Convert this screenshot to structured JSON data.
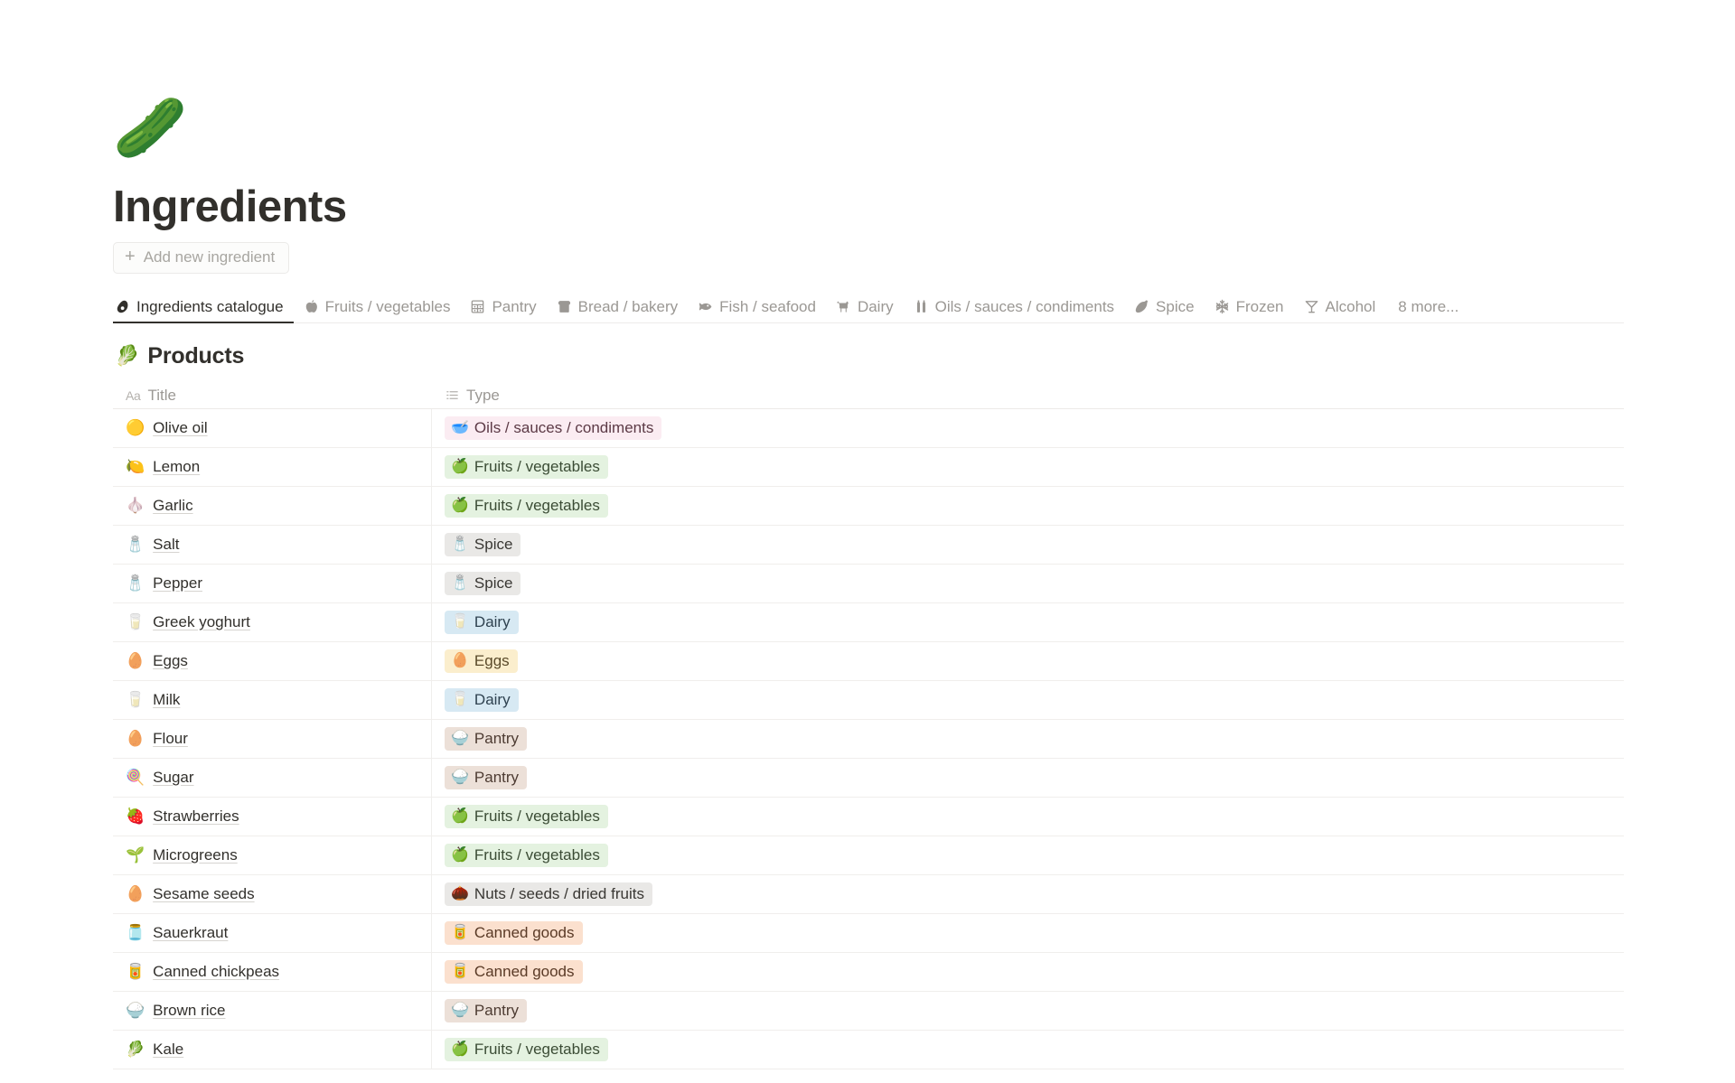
{
  "header": {
    "emoji": "🥒",
    "emoji_name": "cucumber-emoji",
    "title": "Ingredients",
    "add_button_label": "Add new ingredient",
    "add_button_plus": "+"
  },
  "tabs": {
    "items": [
      {
        "label": "Ingredients catalogue",
        "icon": "avocado-icon",
        "active": true
      },
      {
        "label": "Fruits / vegetables",
        "icon": "apple-icon",
        "active": false
      },
      {
        "label": "Pantry",
        "icon": "cabinet-icon",
        "active": false
      },
      {
        "label": "Bread / bakery",
        "icon": "bread-icon",
        "active": false
      },
      {
        "label": "Fish / seafood",
        "icon": "fish-icon",
        "active": false
      },
      {
        "label": "Dairy",
        "icon": "cow-icon",
        "active": false
      },
      {
        "label": "Oils / sauces / condiments",
        "icon": "bottles-icon",
        "active": false
      },
      {
        "label": "Spice",
        "icon": "chili-pepper-icon",
        "active": false
      },
      {
        "label": "Frozen",
        "icon": "snowflake-icon",
        "active": false
      },
      {
        "label": "Alcohol",
        "icon": "cocktail-glass-icon",
        "active": false
      }
    ],
    "more_label": "8 more..."
  },
  "section": {
    "emoji": "🥬",
    "emoji_name": "leafy-green-emoji",
    "title": "Products"
  },
  "table": {
    "columns": [
      {
        "label": "Title",
        "icon": "text-type-icon"
      },
      {
        "label": "Type",
        "icon": "multi-select-icon"
      }
    ],
    "rows": [
      {
        "emoji": "🟡",
        "title": "Olive oil",
        "tag_emoji": "🥣",
        "tag": "Oils / sauces / condiments",
        "tag_style": "pink"
      },
      {
        "emoji": "🍋",
        "title": "Lemon",
        "tag_emoji": "🍏",
        "tag": "Fruits / vegetables",
        "tag_style": "green"
      },
      {
        "emoji": "🧄",
        "title": "Garlic",
        "tag_emoji": "🍏",
        "tag": "Fruits / vegetables",
        "tag_style": "green"
      },
      {
        "emoji": "🧂",
        "title": "Salt",
        "tag_emoji": "🧂",
        "tag": "Spice",
        "tag_style": "gray"
      },
      {
        "emoji": "🧂",
        "title": "Pepper",
        "tag_emoji": "🧂",
        "tag": "Spice",
        "tag_style": "gray"
      },
      {
        "emoji": "🥛",
        "title": "Greek yoghurt",
        "tag_emoji": "🥛",
        "tag": "Dairy",
        "tag_style": "blue"
      },
      {
        "emoji": "🥚",
        "title": "Eggs",
        "tag_emoji": "🥚",
        "tag": "Eggs",
        "tag_style": "yellow"
      },
      {
        "emoji": "🥛",
        "title": "Milk",
        "tag_emoji": "🥛",
        "tag": "Dairy",
        "tag_style": "blue"
      },
      {
        "emoji": "🥚",
        "title": "Flour",
        "tag_emoji": "🍚",
        "tag": "Pantry",
        "tag_style": "brown"
      },
      {
        "emoji": "🍭",
        "title": "Sugar",
        "tag_emoji": "🍚",
        "tag": "Pantry",
        "tag_style": "brown"
      },
      {
        "emoji": "🍓",
        "title": "Strawberries",
        "tag_emoji": "🍏",
        "tag": "Fruits / vegetables",
        "tag_style": "green"
      },
      {
        "emoji": "🌱",
        "title": "Microgreens",
        "tag_emoji": "🍏",
        "tag": "Fruits / vegetables",
        "tag_style": "green"
      },
      {
        "emoji": "🥚",
        "title": "Sesame seeds",
        "tag_emoji": "🌰",
        "tag": "Nuts / seeds / dried fruits",
        "tag_style": "gray"
      },
      {
        "emoji": "🫙",
        "title": "Sauerkraut",
        "tag_emoji": "🥫",
        "tag": "Canned goods",
        "tag_style": "orange"
      },
      {
        "emoji": "🥫",
        "title": "Canned chickpeas",
        "tag_emoji": "🥫",
        "tag": "Canned goods",
        "tag_style": "orange"
      },
      {
        "emoji": "🍚",
        "title": "Brown rice",
        "tag_emoji": "🍚",
        "tag": "Pantry",
        "tag_style": "brown"
      },
      {
        "emoji": "🥬",
        "title": "Kale",
        "tag_emoji": "🍏",
        "tag": "Fruits / vegetables",
        "tag_style": "green"
      }
    ]
  },
  "tag_colors": {
    "pink": {
      "bg": "#fbecf2",
      "fg": "#5c3a46"
    },
    "green": {
      "bg": "#e4f2e0",
      "fg": "#3b4c35"
    },
    "gray": {
      "bg": "#e9e8e6",
      "fg": "#393733"
    },
    "blue": {
      "bg": "#d7e9f3",
      "fg": "#2f4250"
    },
    "yellow": {
      "bg": "#fbeecd",
      "fg": "#5a4a2a"
    },
    "brown": {
      "bg": "#ece0d8",
      "fg": "#4d3b32"
    },
    "orange": {
      "bg": "#fbe0ce",
      "fg": "#5a3a26"
    }
  }
}
